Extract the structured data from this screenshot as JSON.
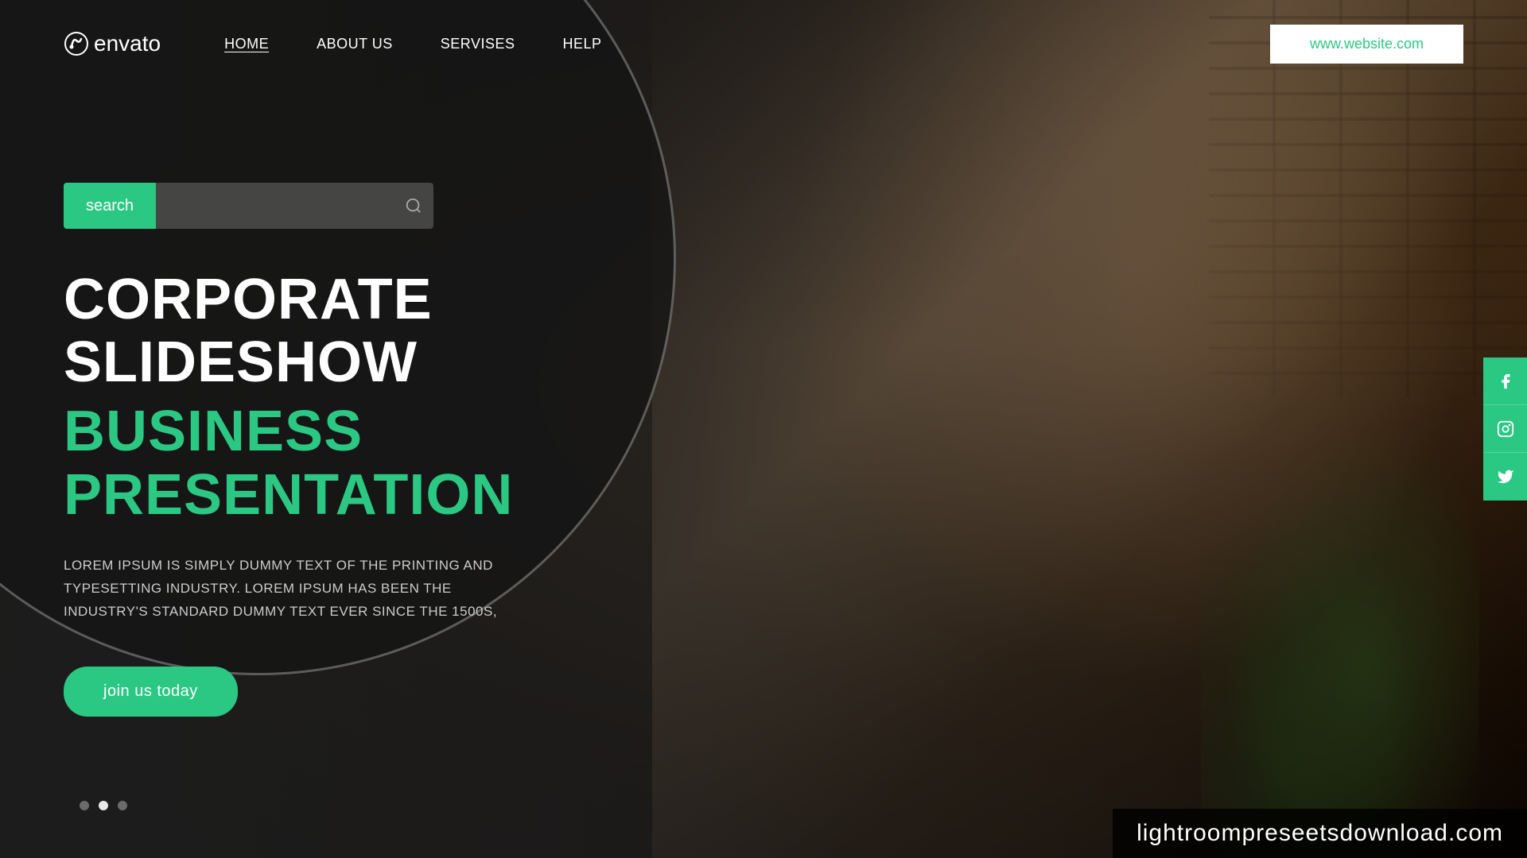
{
  "logo": {
    "text": "envato",
    "icon": "leaf-icon"
  },
  "nav": {
    "items": [
      {
        "label": "HOME",
        "active": true
      },
      {
        "label": "ABOUT US",
        "active": false
      },
      {
        "label": "SERVISES",
        "active": false
      },
      {
        "label": "HELP",
        "active": false
      }
    ],
    "website_url": "www.website.com"
  },
  "search": {
    "label": "search",
    "placeholder": ""
  },
  "hero": {
    "headline_white": "CORPORATE SLIDESHOW",
    "headline_green": "BUSINESS PRESENTATION",
    "description": "LOREM IPSUM IS SIMPLY DUMMY TEXT OF THE PRINTING AND TYPESETTING INDUSTRY. LOREM IPSUM HAS BEEN THE INDUSTRY'S STANDARD DUMMY TEXT EVER SINCE THE 1500S,",
    "cta_button": "join us today"
  },
  "social": {
    "items": [
      {
        "name": "facebook",
        "label": "Facebook"
      },
      {
        "name": "instagram",
        "label": "Instagram"
      },
      {
        "name": "twitter",
        "label": "Twitter"
      }
    ]
  },
  "slideshow": {
    "dots": [
      {
        "active": false
      },
      {
        "active": true
      },
      {
        "active": false
      }
    ]
  },
  "watermark": {
    "text": "lightroompreseetsdownload.com"
  },
  "colors": {
    "accent": "#2bc884",
    "white": "#ffffff",
    "dark_bg": "#1a1a1a"
  }
}
